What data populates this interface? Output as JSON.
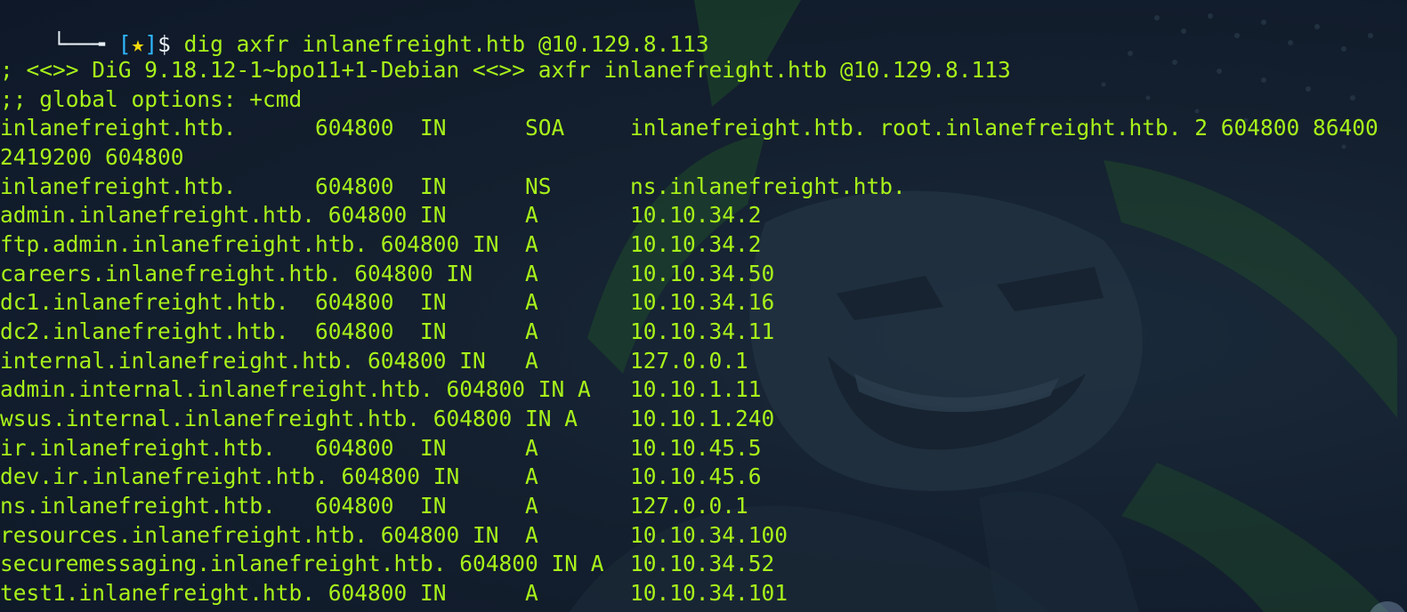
{
  "prompt": {
    "corner": "└──╼",
    "open_bracket": "[",
    "star": "★",
    "close_bracket": "]",
    "sigil": "$",
    "command": "dig axfr inlanefreight.htb @10.129.8.113"
  },
  "output_lines": [
    "",
    "; <<>> DiG 9.18.12-1~bpo11+1-Debian <<>> axfr inlanefreight.htb @10.129.8.113",
    ";; global options: +cmd",
    "inlanefreight.htb.      604800  IN      SOA     inlanefreight.htb. root.inlanefreight.htb. 2 604800 86400",
    "2419200 604800",
    "inlanefreight.htb.      604800  IN      NS      ns.inlanefreight.htb.",
    "admin.inlanefreight.htb. 604800 IN      A       10.10.34.2",
    "ftp.admin.inlanefreight.htb. 604800 IN  A       10.10.34.2",
    "careers.inlanefreight.htb. 604800 IN    A       10.10.34.50",
    "dc1.inlanefreight.htb.  604800  IN      A       10.10.34.16",
    "dc2.inlanefreight.htb.  604800  IN      A       10.10.34.11",
    "internal.inlanefreight.htb. 604800 IN   A       127.0.0.1",
    "admin.internal.inlanefreight.htb. 604800 IN A   10.10.1.11",
    "wsus.internal.inlanefreight.htb. 604800 IN A    10.10.1.240",
    "ir.inlanefreight.htb.   604800  IN      A       10.10.45.5",
    "dev.ir.inlanefreight.htb. 604800 IN     A       10.10.45.6",
    "ns.inlanefreight.htb.   604800  IN      A       127.0.0.1",
    "resources.inlanefreight.htb. 604800 IN  A       10.10.34.100",
    "securemessaging.inlanefreight.htb. 604800 IN A  10.10.34.52",
    "test1.inlanefreight.htb. 604800 IN      A       10.10.34.101"
  ],
  "colors": {
    "output": "#a8f21a",
    "bracket": "#2fb8ff",
    "star": "#f5d90a",
    "background": "#14202f"
  }
}
